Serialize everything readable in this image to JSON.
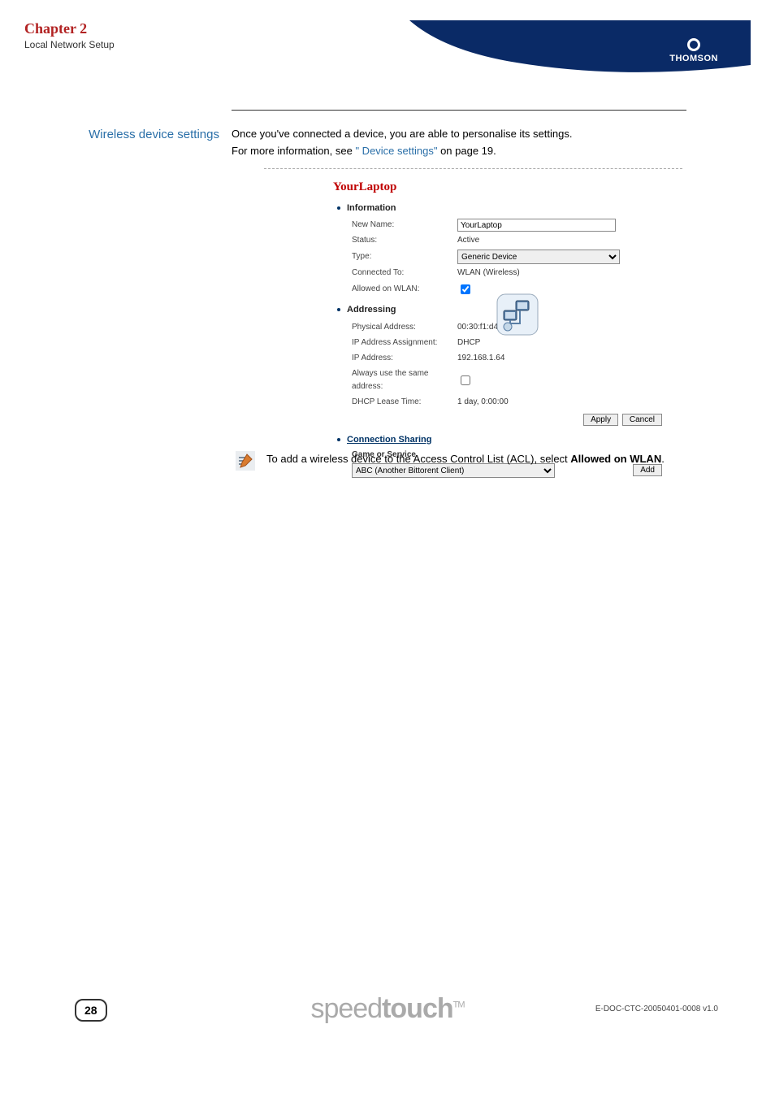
{
  "header": {
    "chapter": "Chapter 2",
    "subtitle": "Local Network Setup",
    "brand": "THOMSON"
  },
  "sectionLabel": "Wireless device settings",
  "intro": {
    "line1": "Once you've connected a device, you are able to personalise its settings.",
    "line2a": "For more information, see ",
    "link": "\" Device settings\"",
    "line2b": " on page 19."
  },
  "device": {
    "title": "YourLaptop",
    "information": {
      "heading": "Information",
      "newNameLabel": "New Name:",
      "newNameValue": "YourLaptop",
      "statusLabel": "Status:",
      "statusValue": "Active",
      "typeLabel": "Type:",
      "typeValue": "Generic Device",
      "connectedToLabel": "Connected To:",
      "connectedToValue": "WLAN (Wireless)",
      "allowedLabel": "Allowed on WLAN:"
    },
    "addressing": {
      "heading": "Addressing",
      "physLabel": "Physical Address:",
      "physValue": "00:30:f1:d4:e7:ff",
      "ipAssignLabel": "IP Address Assignment:",
      "ipAssignValue": "DHCP",
      "ipLabel": "IP Address:",
      "ipValue": "192.168.1.64",
      "sameAddrLabel": "Always use the same address:",
      "leaseLabel": "DHCP Lease Time:",
      "leaseValue": "1 day, 0:00:00"
    },
    "buttons": {
      "apply": "Apply",
      "cancel": "Cancel",
      "add": "Add"
    },
    "connection": {
      "heading": "Connection Sharing",
      "gameLabel": "Game or Service",
      "gameValue": "ABC (Another Bittorent Client)"
    }
  },
  "note": {
    "pre": "To add a wireless device to the Access Control List (ACL), select ",
    "bold": "Allowed on WLAN",
    "post": "."
  },
  "footer": {
    "pageNum": "28",
    "logo1": "speed",
    "logo2": "touch",
    "tm": "TM",
    "docid": "E-DOC-CTC-20050401-0008 v1.0"
  }
}
